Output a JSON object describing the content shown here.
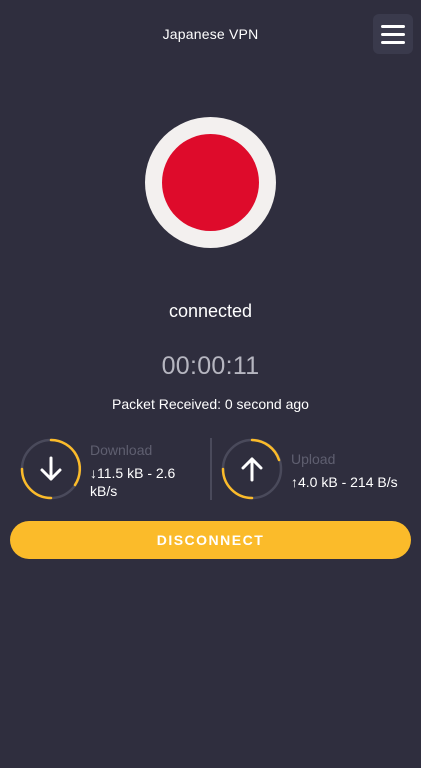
{
  "header": {
    "title": "Japanese VPN",
    "menu_icon": "hamburger-menu-icon"
  },
  "flag": {
    "icon": "japan-flag-icon",
    "ring_color": "#f3f0ef",
    "disc_color": "#de0b2b"
  },
  "connection": {
    "status": "connected",
    "elapsed": "00:00:11",
    "packet_received": "Packet Received: 0 second ago"
  },
  "download": {
    "label": "Download",
    "value_line1": "↓11.5 kB - 2.6",
    "value_line2": "kB/s",
    "icon": "arrow-down-icon"
  },
  "upload": {
    "label": "Upload",
    "value": "↑4.0 kB - 214 B/s",
    "icon": "arrow-up-icon"
  },
  "actions": {
    "disconnect_label": "DISCONNECT"
  },
  "colors": {
    "background": "#2f2e3e",
    "accent": "#fbbb2a",
    "muted_text": "#5f5f70",
    "timer_text": "#b6b6c0"
  }
}
